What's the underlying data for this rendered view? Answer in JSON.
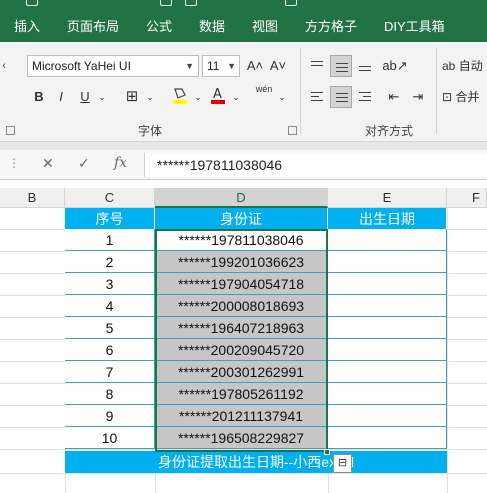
{
  "ribbon_tabs": [
    "插入",
    "页面布局",
    "公式",
    "数据",
    "视图",
    "方方格子",
    "DIY工具箱"
  ],
  "font": {
    "name": "Microsoft YaHei UI",
    "size": "11"
  },
  "ribbon_buttons": {
    "grow_font": "A˄",
    "shrink_font": "A˅",
    "bold": "B",
    "italic": "I",
    "underline": "U",
    "phonetic": "wén",
    "wrap_text": "自动",
    "merge": "合并"
  },
  "group_labels": {
    "font": "字体",
    "alignment": "对齐方式"
  },
  "formula_bar": {
    "fx": "fx",
    "value": "******197811038046"
  },
  "columns": [
    {
      "letter": "B"
    },
    {
      "letter": "C"
    },
    {
      "letter": "D"
    },
    {
      "letter": "E"
    },
    {
      "letter": "F"
    }
  ],
  "table": {
    "headers": [
      "序号",
      "身份证",
      "出生日期"
    ],
    "rows": [
      {
        "no": "1",
        "id": "******197811038046",
        "date": ""
      },
      {
        "no": "2",
        "id": "******199201036623",
        "date": ""
      },
      {
        "no": "3",
        "id": "******197904054718",
        "date": ""
      },
      {
        "no": "4",
        "id": "******200008018693",
        "date": ""
      },
      {
        "no": "5",
        "id": "******196407218963",
        "date": ""
      },
      {
        "no": "6",
        "id": "******200209045720",
        "date": ""
      },
      {
        "no": "7",
        "id": "******200301262991",
        "date": ""
      },
      {
        "no": "8",
        "id": "******197805261192",
        "date": ""
      },
      {
        "no": "9",
        "id": "******201211137941",
        "date": ""
      },
      {
        "no": "10",
        "id": "******196508229827",
        "date": ""
      }
    ],
    "footer": "身份证提取出生日期--小西excel"
  },
  "colors": {
    "ribbon_green": "#217346",
    "header_fill": "#00b0f0",
    "selected_fill": "#c6c6c6"
  }
}
